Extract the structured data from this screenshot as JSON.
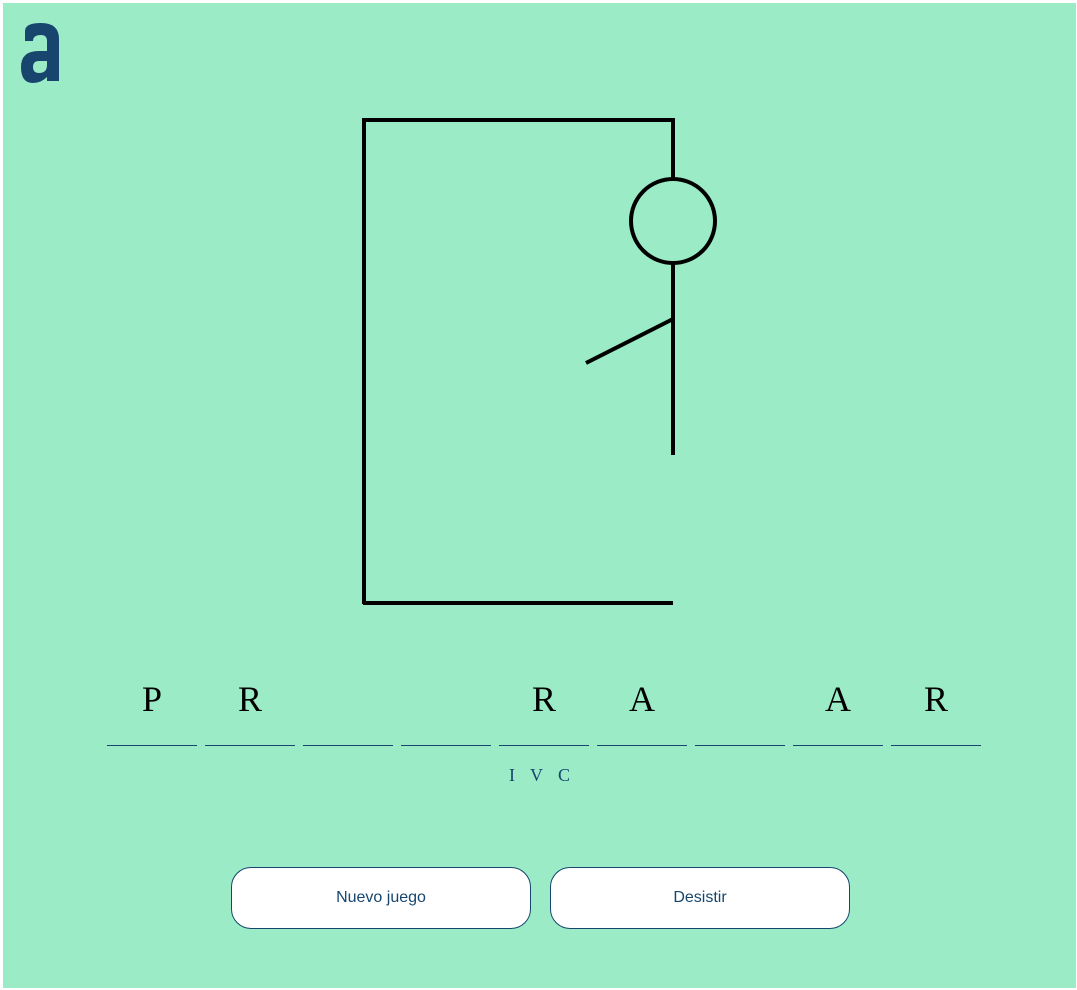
{
  "theme": {
    "background": "#9aebc6",
    "accent": "#17456e",
    "stroke": "#000000",
    "button_bg": "#ffffff"
  },
  "logo": {
    "icon": "alura-a-logo",
    "text": "a"
  },
  "hangman": {
    "parts_drawn": [
      "head",
      "body",
      "left-arm"
    ]
  },
  "word": {
    "slots": [
      {
        "letter": "P"
      },
      {
        "letter": "R"
      },
      {
        "letter": ""
      },
      {
        "letter": ""
      },
      {
        "letter": "R"
      },
      {
        "letter": "A"
      },
      {
        "letter": ""
      },
      {
        "letter": "A"
      },
      {
        "letter": "R"
      }
    ]
  },
  "wrong_letters": [
    "I",
    "V",
    "C"
  ],
  "buttons": {
    "new_game": "Nuevo juego",
    "give_up": "Desistir"
  }
}
